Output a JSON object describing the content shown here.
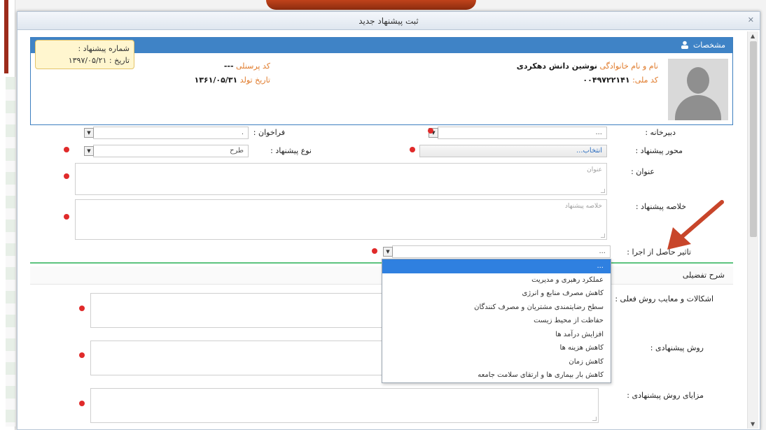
{
  "window": {
    "title": "ثبت پیشنهاد جدید",
    "close_glyph": "✕"
  },
  "profile": {
    "header_label": "مشخصات",
    "name_label": "نام و نام خانوادگی",
    "name_value": "نوشین دانش دهکردی",
    "national_code_label": "کد ملی",
    "national_code_value": "۰۰۴۹۷۲۲۱۴۱",
    "personnel_code_label": "کد پرسنلی",
    "personnel_code_value": "---",
    "birth_date_label": "تاریخ تولد",
    "birth_date_value": "۱۳۶۱/۰۵/۳۱",
    "suggestion_number_label": "شماره پیشنهاد :",
    "suggestion_number_value": "",
    "date_label": "تاریخ :",
    "date_value": "۱۳۹۷/۰۵/۲۱"
  },
  "form": {
    "secretariat_label": "دبیرخانه :",
    "secretariat_value": "...",
    "call_label": "فراخوان :",
    "call_value": ".",
    "axis_label": "محور پیشنهاد :",
    "axis_value": "انتخاب...",
    "type_label": "نوع پیشنهاد :",
    "type_value": "طرح",
    "title_label": "عنوان :",
    "title_placeholder": "عنوان",
    "summary_label": "خلاصه پیشنهاد :",
    "summary_placeholder": "خلاصه پیشنهاد",
    "impact_label": "تاثیر حاصل از اجرا :",
    "impact_value": "...",
    "detail_header": "شرح تفضیلی",
    "problems_label": "اشکالات و معایب روش فعلی :",
    "proposed_method_label": "روش پیشنهادی :",
    "advantages_label": "مزایای روش پیشنهادی :"
  },
  "dropdown": {
    "options": [
      "...",
      "عملکرد رهبری و مدیریت",
      "کاهش مصرف منابع و انرژی",
      "سطح رضایتمندی مشتریان و مصرف کنندگان",
      "حفاظت از محیط زیست",
      "افزایش درآمد ها",
      "کاهش هزینه ها",
      "کاهش زمان",
      "کاهش بار بیماری ها و ارتقای سلامت جامعه"
    ],
    "selected_index": 0
  },
  "colors": {
    "accent": "#3f83c6",
    "required": "#e02a2a",
    "label_orange": "#e07a2a",
    "divider_green": "#5cc37e",
    "annotation_arrow": "#c8452a"
  },
  "icons": {
    "dropdown_button": "▼",
    "scroll_up": "▲",
    "scroll_down": "▼"
  }
}
